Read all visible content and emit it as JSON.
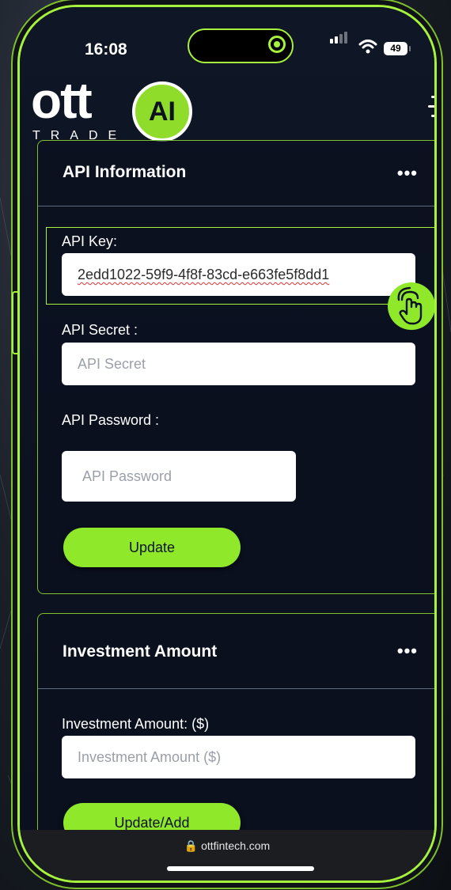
{
  "status_bar": {
    "time": "16:08",
    "battery": "49"
  },
  "brand": {
    "logo_word": "ott",
    "logo_badge": "AI",
    "logo_sub": "TRADE"
  },
  "api_card": {
    "title": "API Information",
    "menu": "•••",
    "key_label": "API Key:",
    "key_value": "2edd1022-59f9-4f8f-83cd-e663fe5f8dd1",
    "secret_label": "API Secret :",
    "secret_placeholder": "API Secret",
    "password_label": "API Password :",
    "password_placeholder": "API Password",
    "update_label": "Update"
  },
  "investment_card": {
    "title": "Investment Amount",
    "menu": "•••",
    "amount_label": "Investment Amount: ($)",
    "amount_placeholder": "Investment Amount ($)",
    "update_add_label": "Update/Add"
  },
  "browser": {
    "url": "🔒 ottfintech.com"
  },
  "colors": {
    "accent": "#8fe82a",
    "frame": "#a6f23d",
    "background": "#0c1220"
  }
}
